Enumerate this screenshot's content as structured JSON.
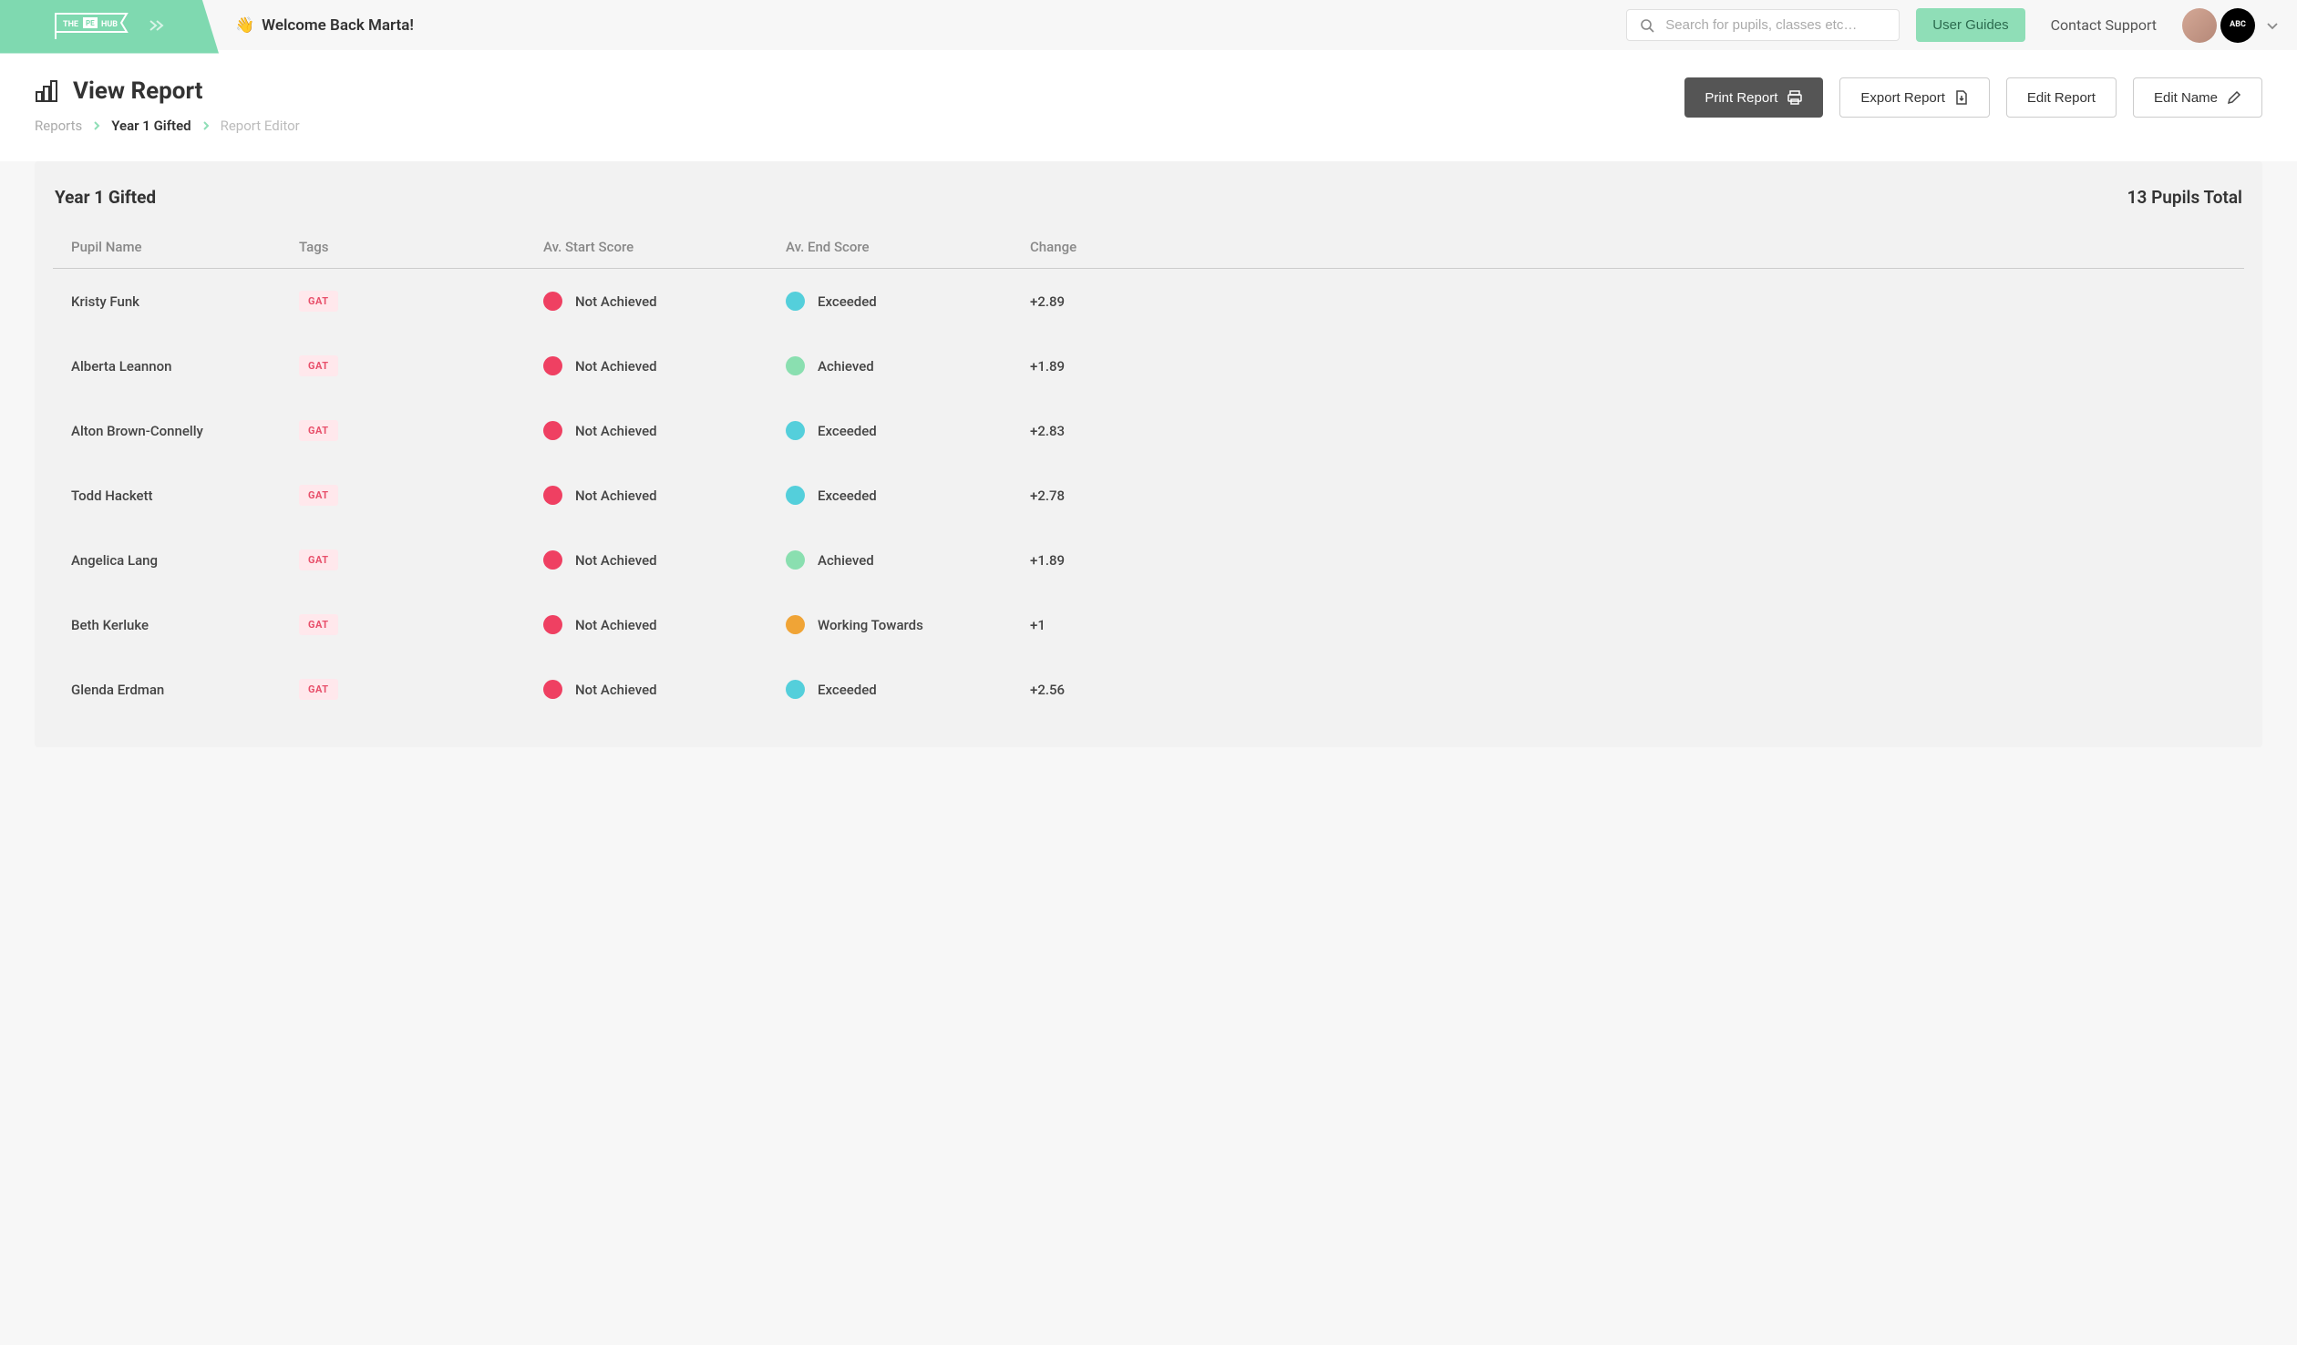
{
  "header": {
    "logo_text": "THE PE HUB",
    "welcome_emoji": "👋",
    "welcome_text": "Welcome Back Marta!",
    "search_placeholder": "Search for pupils, classes etc…",
    "user_guides_label": "User Guides",
    "contact_label": "Contact Support",
    "school_logo_text": "ABC"
  },
  "page": {
    "title": "View Report",
    "breadcrumb": {
      "reports": "Reports",
      "class": "Year 1 Gifted",
      "editor": "Report Editor"
    },
    "actions": {
      "print": "Print Report",
      "export": "Export Report",
      "edit_report": "Edit Report",
      "edit_name": "Edit Name"
    }
  },
  "report": {
    "title": "Year 1 Gifted",
    "count_label": "13 Pupils Total",
    "columns": {
      "name": "Pupil Name",
      "tags": "Tags",
      "start": "Av. Start Score",
      "end": "Av. End Score",
      "change": "Change"
    },
    "tag_label": "GAT",
    "scores": {
      "not_achieved": "Not Achieved",
      "exceeded": "Exceeded",
      "achieved": "Achieved",
      "working_towards": "Working Towards"
    },
    "rows": [
      {
        "name": "Kristy Funk",
        "tag": "GAT",
        "start": "not_achieved",
        "end": "exceeded",
        "change": "+2.89"
      },
      {
        "name": "Alberta Leannon",
        "tag": "GAT",
        "start": "not_achieved",
        "end": "achieved",
        "change": "+1.89"
      },
      {
        "name": "Alton Brown-Connelly",
        "tag": "GAT",
        "start": "not_achieved",
        "end": "exceeded",
        "change": "+2.83"
      },
      {
        "name": "Todd Hackett",
        "tag": "GAT",
        "start": "not_achieved",
        "end": "exceeded",
        "change": "+2.78"
      },
      {
        "name": "Angelica Lang",
        "tag": "GAT",
        "start": "not_achieved",
        "end": "achieved",
        "change": "+1.89"
      },
      {
        "name": "Beth Kerluke",
        "tag": "GAT",
        "start": "not_achieved",
        "end": "working_towards",
        "change": "+1"
      },
      {
        "name": "Glenda Erdman",
        "tag": "GAT",
        "start": "not_achieved",
        "end": "exceeded",
        "change": "+2.56"
      }
    ]
  },
  "colors": {
    "not_achieved": "dot-red",
    "exceeded": "dot-teal",
    "achieved": "dot-green",
    "working_towards": "dot-orange"
  }
}
